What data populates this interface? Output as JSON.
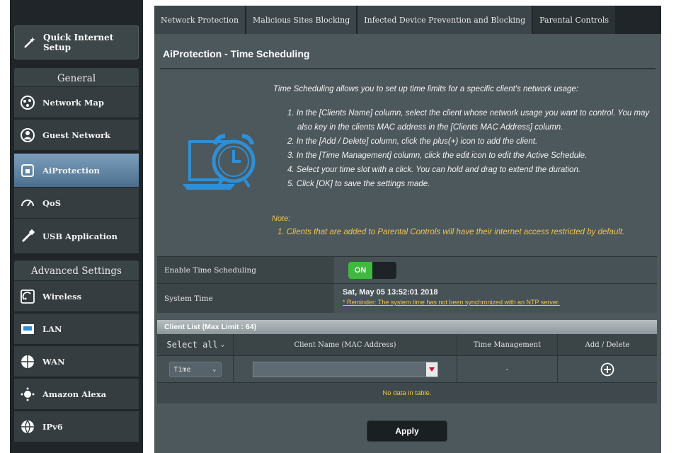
{
  "sidebar": {
    "quick_setup": "Quick Internet Setup",
    "general_title": "General",
    "general_items": [
      {
        "label": "Network Map",
        "icon": "network-map-icon"
      },
      {
        "label": "Guest Network",
        "icon": "guest-network-icon"
      },
      {
        "label": "AiProtection",
        "icon": "aiprotection-icon",
        "active": true
      },
      {
        "label": "QoS",
        "icon": "qos-icon"
      },
      {
        "label": "USB Application",
        "icon": "usb-icon"
      }
    ],
    "advanced_title": "Advanced Settings",
    "advanced_items": [
      {
        "label": "Wireless",
        "icon": "wireless-icon"
      },
      {
        "label": "LAN",
        "icon": "lan-icon"
      },
      {
        "label": "WAN",
        "icon": "wan-icon"
      },
      {
        "label": "Amazon Alexa",
        "icon": "alexa-icon"
      },
      {
        "label": "IPv6",
        "icon": "ipv6-icon"
      }
    ]
  },
  "tabs": [
    {
      "label": "Network Protection"
    },
    {
      "label": "Malicious Sites Blocking"
    },
    {
      "label": "Infected Device Prevention and Blocking"
    },
    {
      "label": "Parental Controls",
      "current": true
    }
  ],
  "page": {
    "title": "AiProtection - Time Scheduling",
    "intro": "Time Scheduling allows you to set up time limits for a specific client's network usage:",
    "steps": [
      "1. In the [Clients Name] column, select the client whose network usage you want to control. You may also key in the clients MAC address in the [Clients MAC Address] column.",
      "2. In the [Add / Delete] column, click the plus(+) icon to add the client.",
      "3. In the [Time Management] column, click the edit icon to edit the Active Schedule.",
      "4. Select your time slot with a click. You can hold and drag to extend the duration.",
      "5. Click [OK] to save the settings made."
    ],
    "note_title": "Note:",
    "note": "1. Clients that are added to Parental Controls will have their internet access restricted by default."
  },
  "settings": {
    "enable_label": "Enable Time Scheduling",
    "toggle_state": "ON",
    "system_time_label": "System Time",
    "system_time": "Sat, May 05 13:52:01 2018",
    "reminder": "* Reminder: The system time has not been synchronized with an NTP server."
  },
  "client_list": {
    "header": "Client List (Max Limit : 64)",
    "select_all": "Select all",
    "col_name": "Client Name (MAC Address)",
    "col_time": "Time Management",
    "col_add": "Add / Delete",
    "time_value": "Time",
    "time_mgmt_value": "-",
    "empty": "No data in table."
  },
  "apply_label": "Apply",
  "colors": {
    "accent_green": "#3fba3f",
    "note_yellow": "#f0c34a",
    "clock_blue": "#2f8fd6"
  }
}
